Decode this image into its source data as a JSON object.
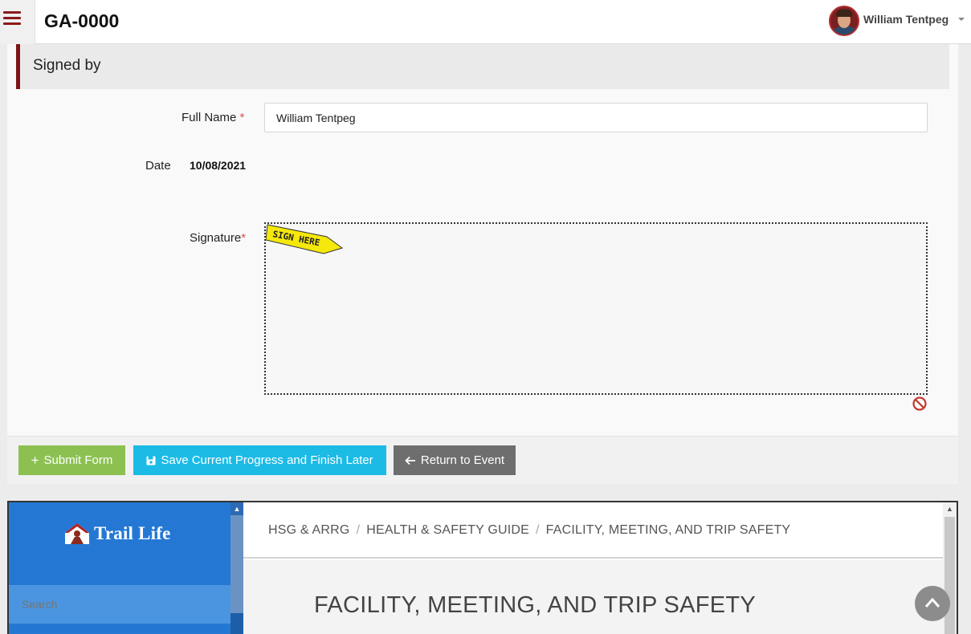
{
  "header": {
    "title": "GA-0000",
    "user_name": "William Tentpeg",
    "icons": {
      "menu": "hamburger-icon",
      "user_menu": "chevron-down-icon"
    }
  },
  "form": {
    "section_title": "Signed by",
    "full_name_label": "Full Name",
    "full_name_value": "William Tentpeg",
    "date_label": "Date",
    "date_value": "10/08/2021",
    "signature_label": "Signature",
    "required_mark": "*",
    "sign_here_label": "SIGN HERE",
    "clear_icon": "no-entry-icon"
  },
  "actions": {
    "submit_label": "Submit Form",
    "save_label": "Save Current Progress and Finish Later",
    "return_label": "Return to Event"
  },
  "embed": {
    "logo_text": "Trail Life",
    "search_placeholder": "Search",
    "breadcrumb": [
      "HSG & ARRG",
      "HEALTH & SAFETY GUIDE",
      "FACILITY, MEETING, AND TRIP SAFETY"
    ],
    "breadcrumb_separator": "/",
    "page_heading": "FACILITY, MEETING, AND TRIP SAFETY"
  },
  "colors": {
    "accent": "#7d1515",
    "submit": "#8cc152",
    "save": "#1cbbe6",
    "return": "#6e6e6e",
    "embed_sidebar": "#2478d4"
  }
}
